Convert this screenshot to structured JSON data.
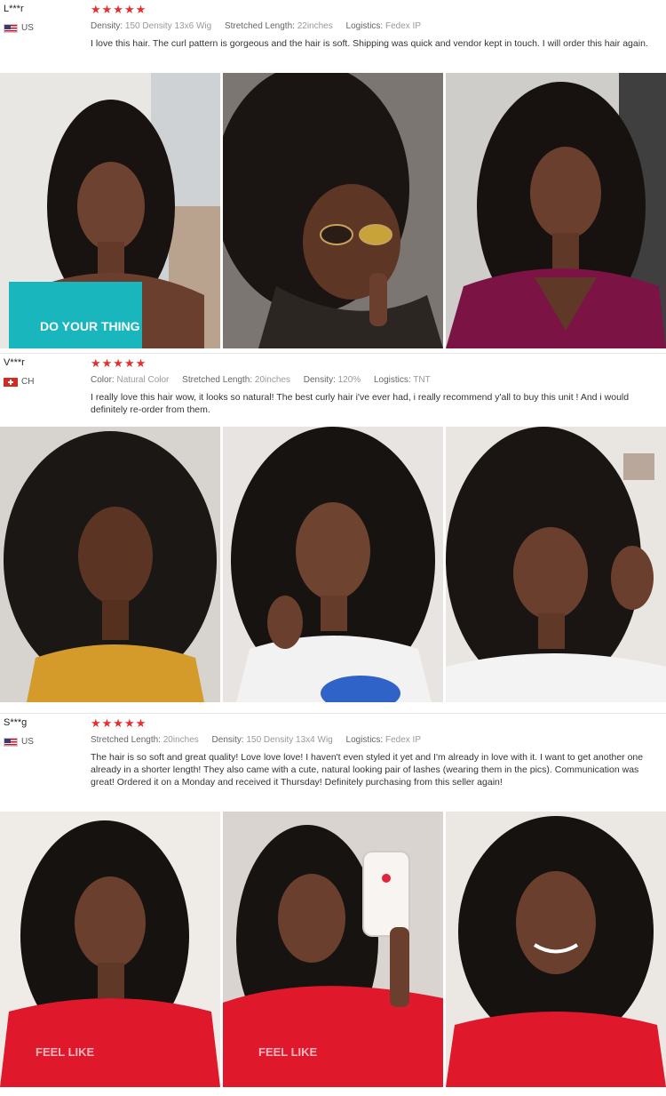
{
  "reviews": [
    {
      "user": "L***r",
      "country": "US",
      "flag_icon": "us-flag-icon",
      "rating_stars": "★★★★★",
      "rating": 5,
      "attributes": [
        {
          "label": "Density:",
          "value": "150 Density 13x6 Wig"
        },
        {
          "label": "Stretched Length:",
          "value": "22inches"
        },
        {
          "label": "Logistics:",
          "value": "Fedex IP"
        }
      ],
      "text": "I love this hair. The curl pattern is gorgeous and the hair is soft. Shipping was quick and vendor kept in touch. I will order this hair again.",
      "photos": [
        {
          "top_text": "DO YOUR THING"
        },
        {},
        {}
      ]
    },
    {
      "user": "V***r",
      "country": "CH",
      "flag_icon": "ch-flag-icon",
      "rating_stars": "★★★★★",
      "rating": 5,
      "attributes": [
        {
          "label": "Color:",
          "value": "Natural Color"
        },
        {
          "label": "Stretched Length:",
          "value": "20inches"
        },
        {
          "label": "Density:",
          "value": "120%"
        },
        {
          "label": "Logistics:",
          "value": "TNT"
        }
      ],
      "text": "I really love this hair wow, it looks so natural! The best curly hair i've ever had, i really recommend y'all to buy this unit ! And i would definitely re-order from them.",
      "photos": [
        {},
        {},
        {}
      ]
    },
    {
      "user": "S***g",
      "country": "US",
      "flag_icon": "us-flag-icon",
      "rating_stars": "★★★★★",
      "rating": 5,
      "attributes": [
        {
          "label": "Stretched Length:",
          "value": "20inches"
        },
        {
          "label": "Density:",
          "value": "150 Density 13x4 Wig"
        },
        {
          "label": "Logistics:",
          "value": "Fedex IP"
        }
      ],
      "text": "The hair is so soft and great quality! Love love love! I haven't even styled it yet and I'm already in love with it. I want to get another one already in a shorter length! They also came with a cute, natural looking pair of lashes (wearing them in the pics). Communication was great! Ordered it on a Monday and received it Thursday! Definitely purchasing from this seller again!",
      "photos": [
        {
          "top_text": "FEEL LIKE"
        },
        {
          "top_text": "FEEL LIKE"
        },
        {}
      ]
    }
  ],
  "colors": {
    "stars": "#e62e2e",
    "divider": "#e6e6e6",
    "hair": "#161210",
    "skin": "#6e4330"
  }
}
